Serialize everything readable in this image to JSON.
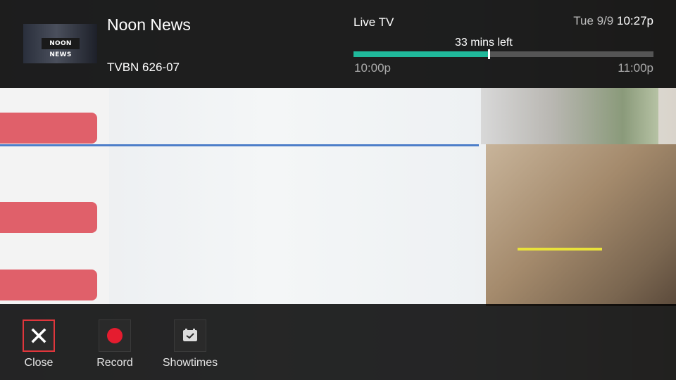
{
  "program": {
    "title": "Noon News",
    "channel": "TVBN 626-07",
    "thumbnail_logo": "NOON NEWS"
  },
  "live": {
    "label": "Live TV",
    "date": "Tue 9/9",
    "time": "10:27p",
    "remaining": "33 mins left",
    "progress": 0.45,
    "start": "10:00p",
    "end": "11:00p"
  },
  "actions": [
    {
      "label": "Close",
      "icon": "close-icon",
      "selected": true
    },
    {
      "label": "Record",
      "icon": "record-icon",
      "selected": false
    },
    {
      "label": "Showtimes",
      "icon": "calendar-icon",
      "selected": false
    }
  ],
  "colors": {
    "progress_fill": "#20b99b",
    "selection": "#e0363c",
    "record": "#e51c2f"
  }
}
